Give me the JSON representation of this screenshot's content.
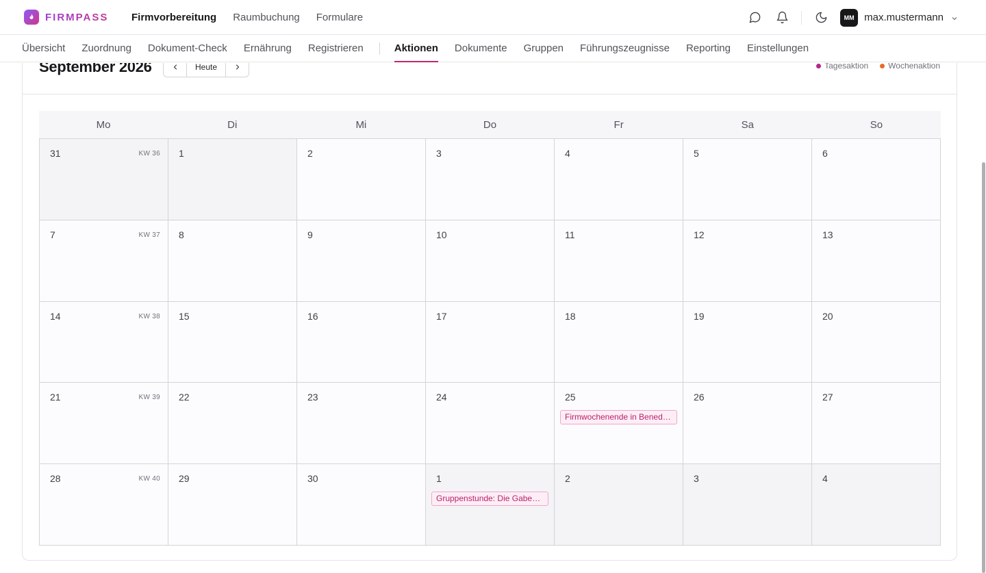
{
  "app": {
    "brand": "FIRMPASS",
    "main_nav": [
      {
        "label": "Firmvorbereitung",
        "active": true
      },
      {
        "label": "Raumbuchung",
        "active": false
      },
      {
        "label": "Formulare",
        "active": false
      }
    ],
    "user": {
      "initials": "MM",
      "name": "max.mustermann"
    }
  },
  "sub_nav": {
    "left": [
      {
        "label": "Übersicht"
      },
      {
        "label": "Zuordnung"
      },
      {
        "label": "Dokument-Check"
      },
      {
        "label": "Ernährung"
      },
      {
        "label": "Registrieren"
      }
    ],
    "right": [
      {
        "label": "Aktionen",
        "active": true
      },
      {
        "label": "Dokumente"
      },
      {
        "label": "Gruppen"
      },
      {
        "label": "Führungszeugnisse"
      },
      {
        "label": "Reporting"
      },
      {
        "label": "Einstellungen"
      }
    ]
  },
  "calendar": {
    "title": "September 2026",
    "today_label": "Heute",
    "legend": [
      {
        "label": "Tagesaktion",
        "color": "#b5268a"
      },
      {
        "label": "Wochenaktion",
        "color": "#ea6a25"
      }
    ],
    "weekdays": [
      "Mo",
      "Di",
      "Mi",
      "Do",
      "Fr",
      "Sa",
      "So"
    ],
    "weeks": [
      {
        "kw": "KW 36",
        "days": [
          {
            "n": "31",
            "outside": true
          },
          {
            "n": "1",
            "outside": true
          },
          {
            "n": "2"
          },
          {
            "n": "3"
          },
          {
            "n": "4"
          },
          {
            "n": "5"
          },
          {
            "n": "6"
          }
        ]
      },
      {
        "kw": "KW 37",
        "days": [
          {
            "n": "7"
          },
          {
            "n": "8"
          },
          {
            "n": "9"
          },
          {
            "n": "10"
          },
          {
            "n": "11"
          },
          {
            "n": "12"
          },
          {
            "n": "13"
          }
        ]
      },
      {
        "kw": "KW 38",
        "days": [
          {
            "n": "14"
          },
          {
            "n": "15"
          },
          {
            "n": "16"
          },
          {
            "n": "17"
          },
          {
            "n": "18"
          },
          {
            "n": "19"
          },
          {
            "n": "20"
          }
        ]
      },
      {
        "kw": "KW 39",
        "days": [
          {
            "n": "21"
          },
          {
            "n": "22"
          },
          {
            "n": "23"
          },
          {
            "n": "24"
          },
          {
            "n": "25",
            "event": "Firmwochenende in Benediktbeuern"
          },
          {
            "n": "26"
          },
          {
            "n": "27"
          }
        ]
      },
      {
        "kw": "KW 40",
        "days": [
          {
            "n": "28"
          },
          {
            "n": "29"
          },
          {
            "n": "30"
          },
          {
            "n": "1",
            "outside": true,
            "event": "Gruppenstunde: Die Gaben des Geistes"
          },
          {
            "n": "2",
            "outside": true
          },
          {
            "n": "3",
            "outside": true
          },
          {
            "n": "4",
            "outside": true
          }
        ]
      }
    ]
  }
}
